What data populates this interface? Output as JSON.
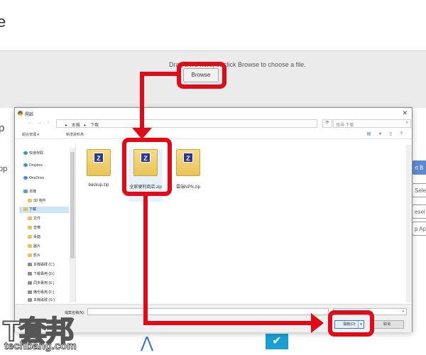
{
  "background": {
    "title": "e",
    "drop_text": "Drag a file here, or click Browse to choose a file.",
    "left_fragments": [
      "p",
      "pp"
    ],
    "right_fragments": [
      "rt B",
      "Sele",
      "esel",
      "p Ap"
    ],
    "browse_label": "Browse"
  },
  "dialog": {
    "title": "開啟",
    "close": "✕",
    "path": [
      "本機",
      "下載"
    ],
    "search_placeholder": "搜尋 下載",
    "toolbar": {
      "organize": "組合管理 ▾",
      "new_folder": "新增資料夾",
      "view_icons": "▤ ▾ ▯ ?"
    },
    "nav": [
      {
        "label": "快速存取",
        "kind": "blue"
      },
      {
        "label": "Dropbox",
        "kind": "blue"
      },
      {
        "label": "OneDrive",
        "kind": "blue"
      },
      {
        "label": "本機",
        "kind": "pc"
      },
      {
        "label": "3D 物件",
        "kind": "folder"
      },
      {
        "label": "下載",
        "kind": "folder",
        "selected": true
      },
      {
        "label": "文件",
        "kind": "folder"
      },
      {
        "label": "音樂",
        "kind": "folder"
      },
      {
        "label": "桌面",
        "kind": "folder"
      },
      {
        "label": "圖片",
        "kind": "folder"
      },
      {
        "label": "影片",
        "kind": "folder"
      },
      {
        "label": "本機磁碟 (C:)",
        "kind": "drive"
      },
      {
        "label": "下載專用 (D:)",
        "kind": "drive"
      },
      {
        "label": "同步專用 (E:)",
        "kind": "drive"
      },
      {
        "label": "備份專用 (F:)",
        "kind": "drive"
      },
      {
        "label": "本機磁碟 (G:)",
        "kind": "drive"
      }
    ],
    "files": [
      {
        "name": "backup.zip"
      },
      {
        "name": "全家便利商店.zip",
        "selected": true
      },
      {
        "name": "雲端NPN.zip"
      }
    ],
    "footer": {
      "filename_label": "檔案名稱(N):",
      "open_label": "開啟(O)",
      "cancel_label": "取消"
    }
  },
  "watermark": {
    "big": "T套邦",
    "small": "techbang.com"
  },
  "colors": {
    "highlight": "#e20a17",
    "accent": "#3b79c7"
  }
}
